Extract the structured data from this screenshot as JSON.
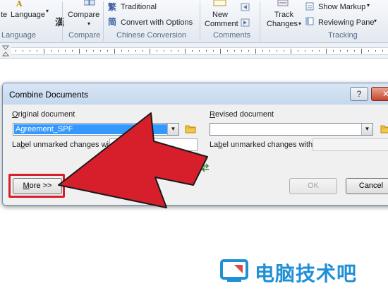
{
  "ribbon": {
    "language_group": {
      "translate_fragment": "te",
      "language_button": "Language",
      "chinese_glyph": "漢",
      "label": "Language"
    },
    "compare_group": {
      "compare_button": "Compare",
      "label": "Compare"
    },
    "chinese_conversion_group": {
      "traditional": "Traditional",
      "convert_with_options": "Convert with Options",
      "label": "Chinese Conversion"
    },
    "comments_group": {
      "new_comment_line1": "New",
      "new_comment_line2": "Comment",
      "label": "Comments"
    },
    "tracking_group": {
      "track_changes_line1": "Track",
      "track_changes_line2": "Changes",
      "show_markup": "Show Markup",
      "reviewing_pane": "Reviewing Pane",
      "label": "Tracking"
    }
  },
  "dialog": {
    "title": "Combine Documents",
    "help_button": "?",
    "close_button": "✕",
    "original": {
      "label": "Original document",
      "value": "Agreement_SPF",
      "unmarked_label": "Label unmarked changes with:"
    },
    "revised": {
      "label": "Revised document",
      "value": "",
      "unmarked_label": "Label unmarked changes with:"
    },
    "more_button": "More >>",
    "ok_button": "OK",
    "cancel_button": "Cancel"
  },
  "annotation": {
    "arrow_color": "#d61f2b",
    "highlight": "more-button"
  },
  "watermark": {
    "text": "电脑技术吧",
    "color": "#1f8fd6"
  }
}
